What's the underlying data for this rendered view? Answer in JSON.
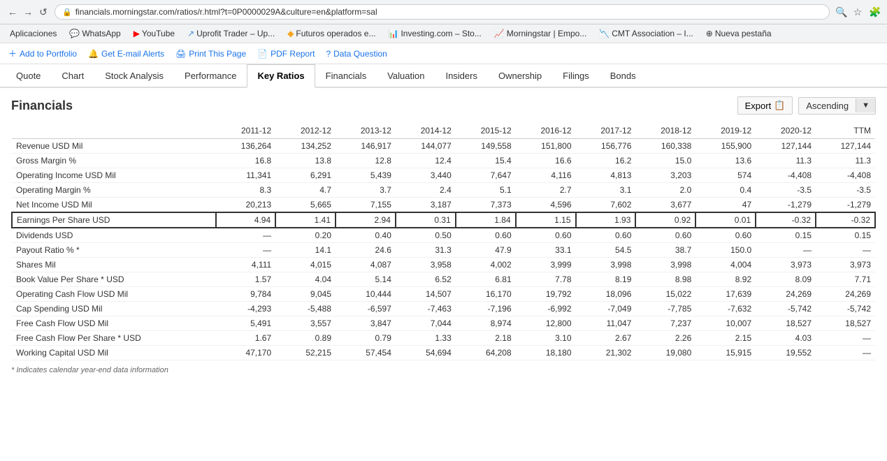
{
  "browser": {
    "url": "financials.morningstar.com/ratios/r.html?t=0P0000029A&culture=en&platform=sal",
    "back_btn": "←",
    "forward_btn": "→",
    "reload_btn": "↺"
  },
  "bookmarks": [
    {
      "id": "aplicaciones",
      "label": "Aplicaciones",
      "icon": ""
    },
    {
      "id": "whatsapp",
      "label": "WhatsApp",
      "icon": "💬",
      "color": "#25D366"
    },
    {
      "id": "youtube",
      "label": "YouTube",
      "icon": "▶",
      "color": "#FF0000"
    },
    {
      "id": "uprofit",
      "label": "Uprofit Trader – Up...",
      "icon": "↗",
      "color": "#4a90d9"
    },
    {
      "id": "futuros",
      "label": "Futuros operados e...",
      "icon": "◆",
      "color": "#f5a623"
    },
    {
      "id": "investing",
      "label": "Investing.com – Sto...",
      "icon": "◼",
      "color": "#d0021b"
    },
    {
      "id": "morningstar",
      "label": "Morningstar | Empo...",
      "icon": "◼",
      "color": "#ef3e42"
    },
    {
      "id": "cmt",
      "label": "CMT Association – I...",
      "icon": "◼",
      "color": "#003087"
    },
    {
      "id": "nueva",
      "label": "Nueva pestaña",
      "icon": "⊕"
    }
  ],
  "toolbar": {
    "add_portfolio": "Add to Portfolio",
    "email_alerts": "Get E-mail Alerts",
    "print_page": "Print This Page",
    "pdf_report": "PDF Report",
    "data_question": "Data Question"
  },
  "nav_tabs": [
    {
      "id": "quote",
      "label": "Quote"
    },
    {
      "id": "chart",
      "label": "Chart"
    },
    {
      "id": "stock_analysis",
      "label": "Stock Analysis"
    },
    {
      "id": "performance",
      "label": "Performance"
    },
    {
      "id": "key_ratios",
      "label": "Key Ratios",
      "active": true
    },
    {
      "id": "financials",
      "label": "Financials"
    },
    {
      "id": "valuation",
      "label": "Valuation"
    },
    {
      "id": "insiders",
      "label": "Insiders"
    },
    {
      "id": "ownership",
      "label": "Ownership"
    },
    {
      "id": "filings",
      "label": "Filings"
    },
    {
      "id": "bonds",
      "label": "Bonds"
    }
  ],
  "section": {
    "title": "Financials",
    "export_label": "Export",
    "sort_label": "Ascending",
    "sort_icon": "▼"
  },
  "table": {
    "columns": [
      "",
      "2011-12",
      "2012-12",
      "2013-12",
      "2014-12",
      "2015-12",
      "2016-12",
      "2017-12",
      "2018-12",
      "2019-12",
      "2020-12",
      "TTM"
    ],
    "rows": [
      {
        "id": "revenue",
        "label": "Revenue",
        "unit": "USD Mil",
        "values": [
          "136,264",
          "134,252",
          "146,917",
          "144,077",
          "149,558",
          "151,800",
          "156,776",
          "160,338",
          "155,900",
          "127,144",
          "127,144"
        ],
        "highlight": false
      },
      {
        "id": "gross_margin",
        "label": "Gross Margin %",
        "unit": "",
        "values": [
          "16.8",
          "13.8",
          "12.8",
          "12.4",
          "15.4",
          "16.6",
          "16.2",
          "15.0",
          "13.6",
          "11.3",
          "11.3"
        ],
        "highlight": false
      },
      {
        "id": "operating_income",
        "label": "Operating Income",
        "unit": "USD Mil",
        "values": [
          "11,341",
          "6,291",
          "5,439",
          "3,440",
          "7,647",
          "4,116",
          "4,813",
          "3,203",
          "574",
          "-4,408",
          "-4,408"
        ],
        "highlight": false
      },
      {
        "id": "operating_margin",
        "label": "Operating Margin %",
        "unit": "",
        "values": [
          "8.3",
          "4.7",
          "3.7",
          "2.4",
          "5.1",
          "2.7",
          "3.1",
          "2.0",
          "0.4",
          "-3.5",
          "-3.5"
        ],
        "highlight": false
      },
      {
        "id": "net_income",
        "label": "Net Income",
        "unit": "USD Mil",
        "values": [
          "20,213",
          "5,665",
          "7,155",
          "3,187",
          "7,373",
          "4,596",
          "7,602",
          "3,677",
          "47",
          "-1,279",
          "-1,279"
        ],
        "highlight": false
      },
      {
        "id": "eps",
        "label": "Earnings Per Share",
        "unit": "USD",
        "values": [
          "4.94",
          "1.41",
          "2.94",
          "0.31",
          "1.84",
          "1.15",
          "1.93",
          "0.92",
          "0.01",
          "-0.32",
          "-0.32"
        ],
        "highlight": true
      },
      {
        "id": "dividends",
        "label": "Dividends",
        "unit": "USD",
        "values": [
          "—",
          "0.20",
          "0.40",
          "0.50",
          "0.60",
          "0.60",
          "0.60",
          "0.60",
          "0.60",
          "0.15",
          "0.15"
        ],
        "highlight": false
      },
      {
        "id": "payout_ratio",
        "label": "Payout Ratio % *",
        "unit": "",
        "values": [
          "—",
          "14.1",
          "24.6",
          "31.3",
          "47.9",
          "33.1",
          "54.5",
          "38.7",
          "150.0",
          "—",
          "—"
        ],
        "highlight": false
      },
      {
        "id": "shares",
        "label": "Shares",
        "unit": "Mil",
        "values": [
          "4,111",
          "4,015",
          "4,087",
          "3,958",
          "4,002",
          "3,999",
          "3,998",
          "3,998",
          "4,004",
          "3,973",
          "3,973"
        ],
        "highlight": false
      },
      {
        "id": "book_value",
        "label": "Book Value Per Share *",
        "unit": "USD",
        "values": [
          "1.57",
          "4.04",
          "5.14",
          "6.52",
          "6.81",
          "7.78",
          "8.19",
          "8.98",
          "8.92",
          "8.09",
          "7.71"
        ],
        "highlight": false
      },
      {
        "id": "operating_cash_flow",
        "label": "Operating Cash Flow",
        "unit": "USD Mil",
        "values": [
          "9,784",
          "9,045",
          "10,444",
          "14,507",
          "16,170",
          "19,792",
          "18,096",
          "15,022",
          "17,639",
          "24,269",
          "24,269"
        ],
        "highlight": false
      },
      {
        "id": "cap_spending",
        "label": "Cap Spending",
        "unit": "USD Mil",
        "values": [
          "-4,293",
          "-5,488",
          "-6,597",
          "-7,463",
          "-7,196",
          "-6,992",
          "-7,049",
          "-7,785",
          "-7,632",
          "-5,742",
          "-5,742"
        ],
        "highlight": false
      },
      {
        "id": "free_cash_flow",
        "label": "Free Cash Flow",
        "unit": "USD Mil",
        "values": [
          "5,491",
          "3,557",
          "3,847",
          "7,044",
          "8,974",
          "12,800",
          "11,047",
          "7,237",
          "10,007",
          "18,527",
          "18,527"
        ],
        "highlight": false
      },
      {
        "id": "free_cash_flow_per_share",
        "label": "Free Cash Flow Per Share *",
        "unit": "USD",
        "values": [
          "1.67",
          "0.89",
          "0.79",
          "1.33",
          "2.18",
          "3.10",
          "2.67",
          "2.26",
          "2.15",
          "4.03",
          "—"
        ],
        "highlight": false
      },
      {
        "id": "working_capital",
        "label": "Working Capital",
        "unit": "USD Mil",
        "values": [
          "47,170",
          "52,215",
          "57,454",
          "54,694",
          "64,208",
          "18,180",
          "21,302",
          "19,080",
          "15,915",
          "19,552",
          "—"
        ],
        "highlight": false
      }
    ],
    "footnote": "* Indicates calendar year-end data information"
  }
}
